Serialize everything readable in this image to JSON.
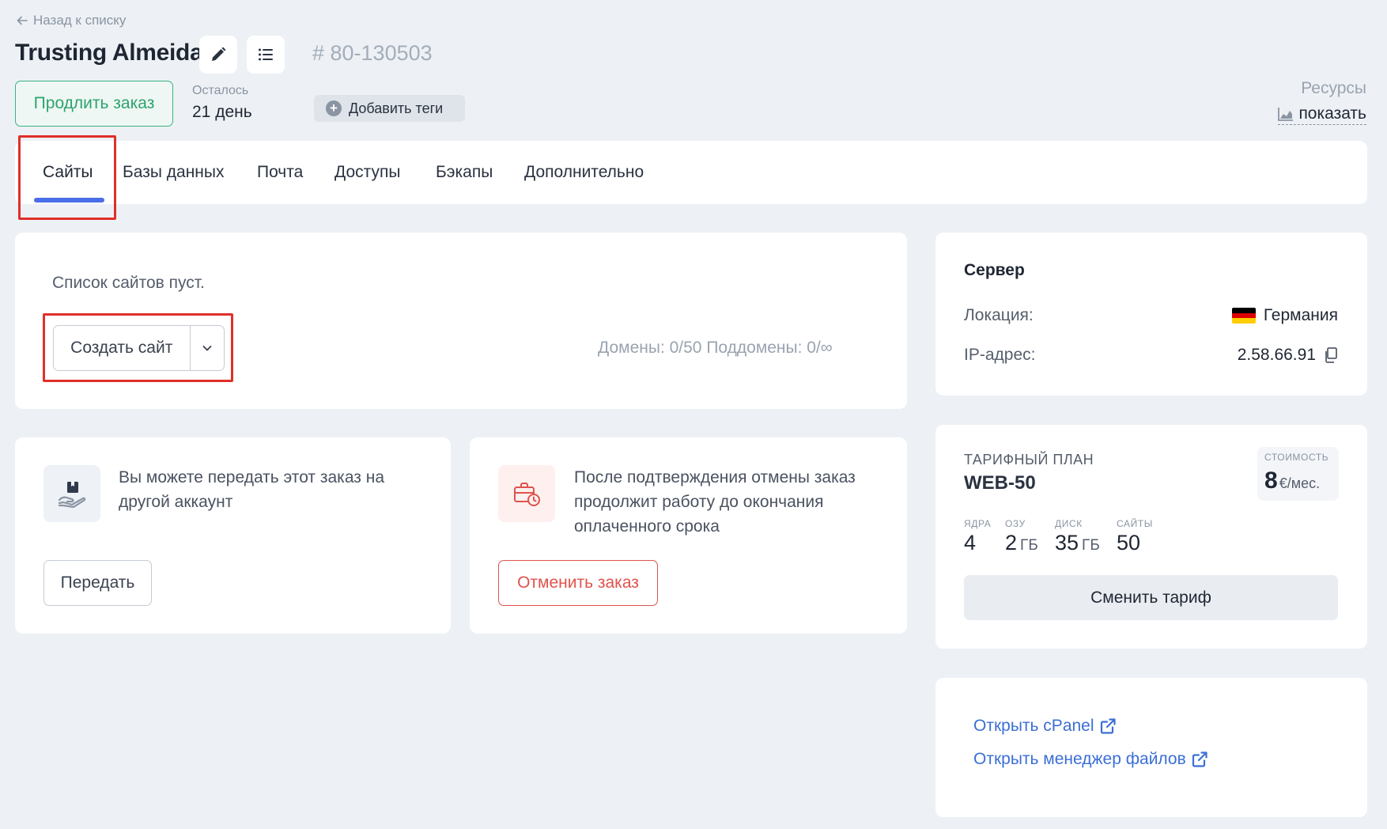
{
  "header": {
    "back_label": "Назад к списку",
    "title": "Trusting Almeida",
    "order_number": "# 80-130503",
    "extend_label": "Продлить заказ",
    "remaining_label": "Осталось",
    "remaining_value": "21 день",
    "add_tags_label": "Добавить теги",
    "resources_label": "Ресурсы",
    "resources_link": "показать"
  },
  "tabs": [
    {
      "label": "Сайты",
      "active": true
    },
    {
      "label": "Базы данных",
      "active": false
    },
    {
      "label": "Почта",
      "active": false
    },
    {
      "label": "Доступы",
      "active": false
    },
    {
      "label": "Бэкапы",
      "active": false
    },
    {
      "label": "Дополнительно",
      "active": false
    }
  ],
  "sites": {
    "empty_text": "Список сайтов пуст.",
    "create_label": "Создать сайт",
    "domains_info": "Домены: 0/50   Поддомены: 0/∞"
  },
  "transfer": {
    "text": "Вы можете передать этот заказ на другой аккаунт",
    "button": "Передать"
  },
  "cancel": {
    "text": "После подтверждения отмены заказ продолжит работу до окончания оплаченного срока",
    "button": "Отменить заказ"
  },
  "server": {
    "title": "Сервер",
    "location_label": "Локация:",
    "location_value": "Германия",
    "ip_label": "IP-адрес:",
    "ip_value": "2.58.66.91"
  },
  "plan": {
    "label": "ТАРИФНЫЙ ПЛАН",
    "name": "WEB-50",
    "cost_label": "СТОИМОСТЬ",
    "cost_value": "8",
    "cost_unit": "€/мес.",
    "specs": [
      {
        "label": "ЯДРА",
        "value": "4",
        "unit": ""
      },
      {
        "label": "ОЗУ",
        "value": "2",
        "unit": "ГБ"
      },
      {
        "label": "ДИСК",
        "value": "35",
        "unit": "ГБ"
      },
      {
        "label": "САЙТЫ",
        "value": "50",
        "unit": ""
      }
    ],
    "change_label": "Сменить тариф"
  },
  "links": {
    "cpanel": "Открыть cPanel",
    "file_manager": "Открыть менеджер файлов"
  },
  "colors": {
    "accent_green": "#3bb27f",
    "accent_blue": "#4a6ee8",
    "danger": "#e0534c",
    "highlight": "#e02f2a",
    "link": "#3b6fd6"
  },
  "icons": [
    "arrow-left-icon",
    "pencil-icon",
    "list-icon",
    "plus-circle-icon",
    "chart-icon",
    "chevron-down-icon",
    "hand-box-icon",
    "briefcase-clock-icon",
    "germany-flag-icon",
    "copy-icon",
    "external-link-icon"
  ]
}
